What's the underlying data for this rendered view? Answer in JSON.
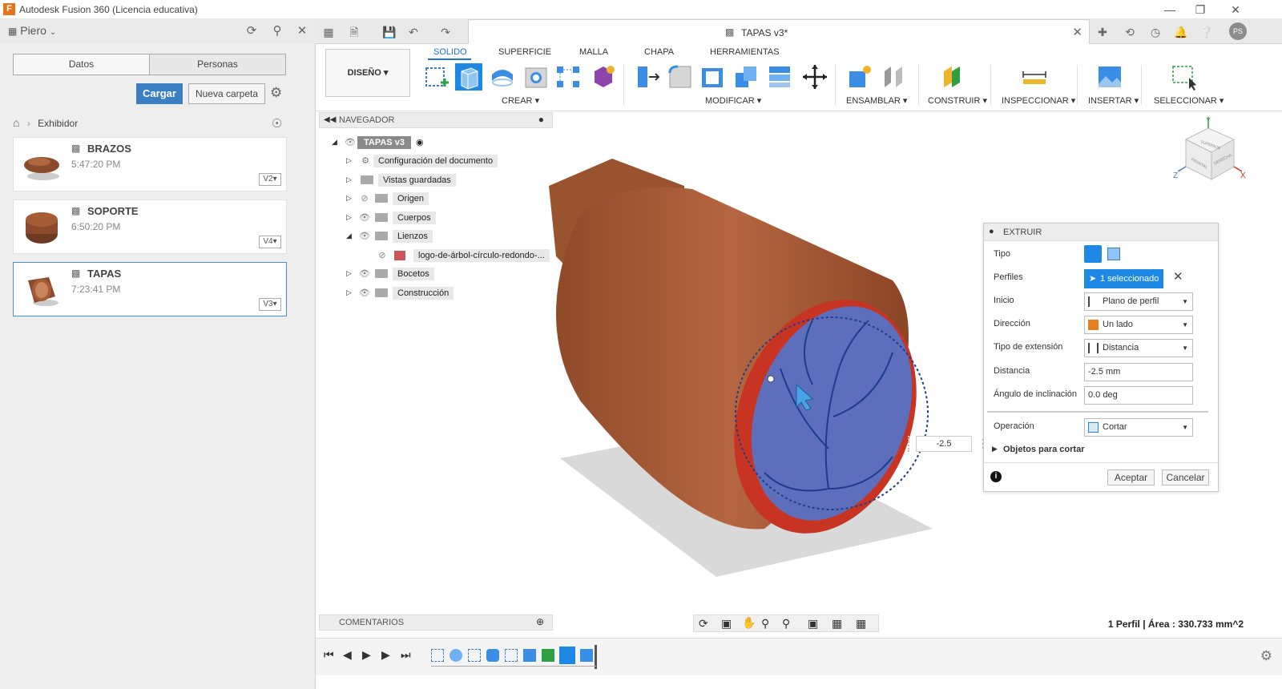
{
  "window": {
    "title": "Autodesk Fusion 360 (Licencia educativa)",
    "logo": "F"
  },
  "left_panel": {
    "user": "Piero",
    "tabs": [
      {
        "label": "Datos"
      },
      {
        "label": "Personas"
      }
    ],
    "upload_label": "Cargar",
    "new_folder_label": "Nueva carpeta",
    "breadcrumb": "Exhibidor",
    "files": [
      {
        "name": "BRAZOS",
        "time": "5:47:20 PM",
        "version": "V2"
      },
      {
        "name": "SOPORTE",
        "time": "6:50:20 PM",
        "version": "V4"
      },
      {
        "name": "TAPAS",
        "time": "7:23:41 PM",
        "version": "V3"
      }
    ]
  },
  "document_tab": {
    "label": "TAPAS v3*"
  },
  "user_initials": "PS",
  "ribbon": {
    "workspace": "DISEÑO",
    "tabs": [
      "SOLIDO",
      "SUPERFICIE",
      "MALLA",
      "CHAPA",
      "HERRAMIENTAS"
    ],
    "active_tab": "SOLIDO",
    "groups": [
      "CREAR",
      "MODIFICAR",
      "ENSAMBLAR",
      "CONSTRUIR",
      "INSPECCIONAR",
      "INSERTAR",
      "SELECCIONAR"
    ]
  },
  "browser": {
    "title": "NAVEGADOR",
    "root": "TAPAS v3",
    "nodes": [
      {
        "label": "Configuración del documento"
      },
      {
        "label": "Vistas guardadas"
      },
      {
        "label": "Origen"
      },
      {
        "label": "Cuerpos"
      },
      {
        "label": "Lienzos"
      },
      {
        "label": "logo-de-árbol-círculo-redondo-..."
      },
      {
        "label": "Bocetos"
      },
      {
        "label": "Construcción"
      }
    ]
  },
  "viewcube": {
    "top": "SUPERIOR",
    "front": "FRONTAL",
    "right": "DERECHA",
    "x": "X",
    "y": "Y",
    "z": "Z"
  },
  "extrude": {
    "title": "EXTRUIR",
    "rows": {
      "tipo": "Tipo",
      "perfiles": "Perfiles",
      "perfiles_value": "1 seleccionado",
      "inicio": "Inicio",
      "inicio_value": "Plano de perfil",
      "direccion": "Dirección",
      "direccion_value": "Un lado",
      "tipo_ext": "Tipo de extensión",
      "tipo_ext_value": "Distancia",
      "distancia": "Distancia",
      "distancia_value": "-2.5 mm",
      "angulo": "Ángulo de inclinación",
      "angulo_value": "0.0 deg",
      "operacion": "Operación",
      "operacion_value": "Cortar",
      "objetos": "Objetos para cortar"
    },
    "ok": "Aceptar",
    "cancel": "Cancelar",
    "distance_tag": "-2.5"
  },
  "comments": {
    "title": "COMENTARIOS"
  },
  "status": "1 Perfil | Área : 330.733 mm^2",
  "colors": {
    "accent": "#1e88e5",
    "wood": "#a0522d",
    "cut": "#d62f1f",
    "preview": "#4a78d8"
  }
}
